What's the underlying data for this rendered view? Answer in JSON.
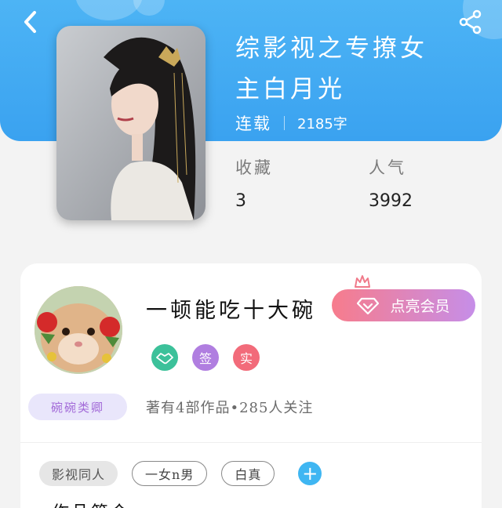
{
  "header": {
    "back_icon": "chevron-left-icon",
    "share_icon": "share-icon",
    "accent_color": "#3aa2f0"
  },
  "book": {
    "title_line1": "综影视之专撩女",
    "title_line2": "主白月光",
    "status": "连载",
    "word_count": "2185字",
    "cover_icon": "cover-image"
  },
  "stats": [
    {
      "label": "收藏",
      "value": "3"
    },
    {
      "label": "人气",
      "value": "3992"
    }
  ],
  "author": {
    "name": "一顿能吃十大碗",
    "vip_label": "点亮会员",
    "badges": [
      {
        "icon": "handshake-icon",
        "text": "",
        "color": "#3cc19a"
      },
      {
        "icon": "sign-badge-icon",
        "text": "签",
        "color": "#b07ee0"
      },
      {
        "icon": "verified-badge-icon",
        "text": "实",
        "color": "#f26b7a"
      }
    ],
    "fan_tag": "碗碗类卿",
    "works_info": "著有4部作品•285人关注"
  },
  "tags": [
    "影视同人",
    "一女n男",
    "白真"
  ],
  "section_heading": "作品简介"
}
